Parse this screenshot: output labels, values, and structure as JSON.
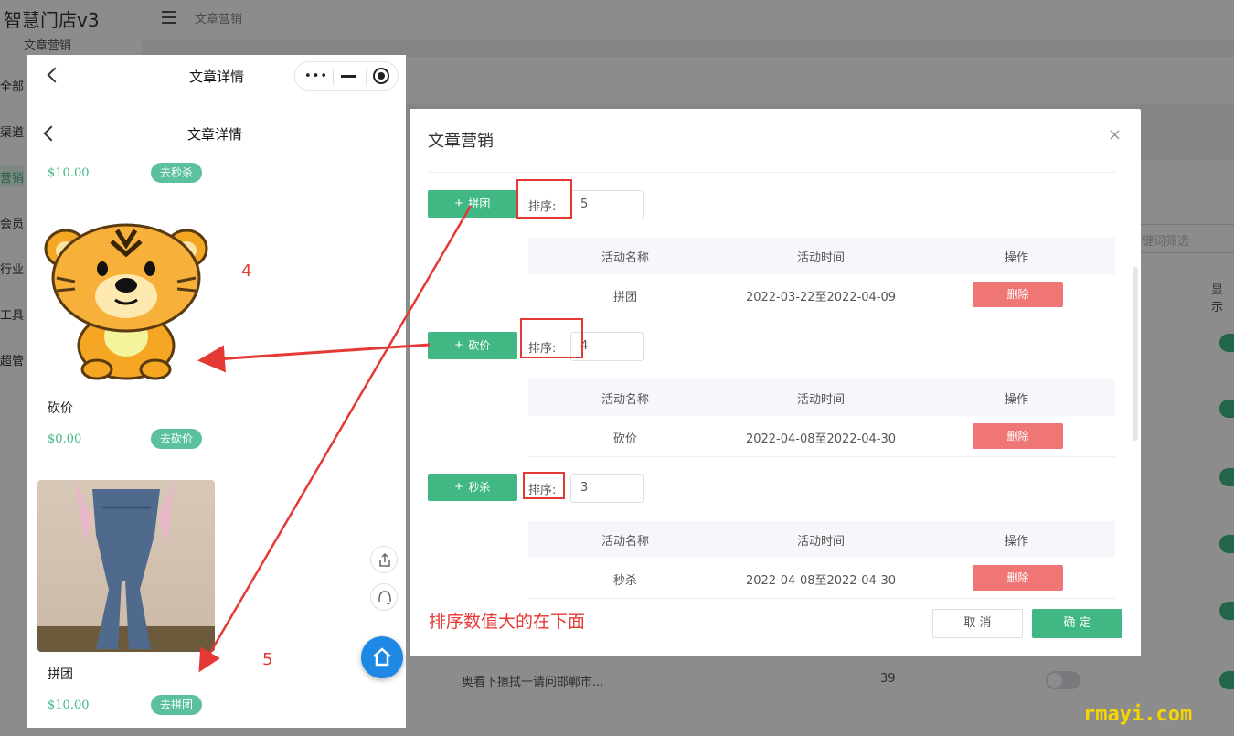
{
  "admin": {
    "brand": "智慧门店v3",
    "brand_sub": "文章营销",
    "sidebar": [
      "全部",
      "渠道",
      "营销",
      "会员",
      "行业",
      "工具",
      "超管"
    ],
    "breadcrumb": "文章营销",
    "filter_placeholder": "键词筛选",
    "column_header": "显示",
    "row_title": "奥看下擦拭一请问邯郸市...",
    "row_count": "39"
  },
  "phone": {
    "nav_title": "文章详情",
    "page_title": "文章详情",
    "items": [
      {
        "price": "$10.00",
        "button": "去秒杀"
      },
      {
        "name": "砍价",
        "price": "$0.00",
        "button": "去砍价"
      },
      {
        "name": "拼团",
        "price": "$10.00",
        "button": "去拼团"
      }
    ]
  },
  "dialog": {
    "title": "文章营销",
    "close": "×",
    "groups": [
      {
        "button": "拼团",
        "sort_label": "排序:",
        "sort_value": "5",
        "row": {
          "name": "拼团",
          "time": "2022-03-22至2022-04-09",
          "action": "删除"
        }
      },
      {
        "button": "砍价",
        "sort_label": "排序:",
        "sort_value": "4",
        "row": {
          "name": "砍价",
          "time": "2022-04-08至2022-04-30",
          "action": "删除"
        }
      },
      {
        "button": "秒杀",
        "sort_label": "排序:",
        "sort_value": "3",
        "row": {
          "name": "秒杀",
          "time": "2022-04-08至2022-04-30",
          "action": "删除"
        }
      }
    ],
    "table_headers": [
      "活动名称",
      "活动时间",
      "操作"
    ],
    "note": "排序数值大的在下面",
    "cancel": "取 消",
    "confirm": "确 定"
  },
  "annotations": {
    "num4": "4",
    "num5": "5",
    "color": "#e53935"
  },
  "watermark": "rmayi.com",
  "colors": {
    "accent": "#41b883",
    "danger": "#f07676"
  }
}
